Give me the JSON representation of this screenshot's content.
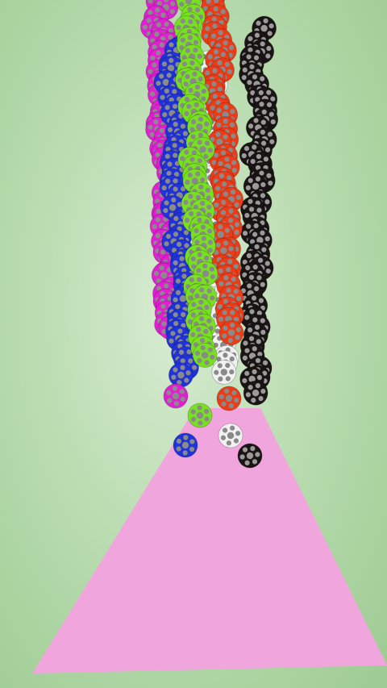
{
  "game": {
    "colors": {
      "background_center": "#d8ecd2",
      "background_edge": "#9fcc94",
      "funnel": "#f0a6dd",
      "magenta": "#e01fd3",
      "blue": "#1f33d8",
      "green": "#78e11f",
      "red": "#ec3c17",
      "white": "#f1f1f1",
      "black": "#1a1414",
      "ball_spot": "#8a8a8a"
    },
    "ball_style": "soccer-ball",
    "streams": [
      "magenta",
      "blue",
      "green",
      "red",
      "white",
      "black"
    ],
    "loose_balls": [
      "magenta",
      "green",
      "red",
      "blue",
      "white",
      "black"
    ]
  }
}
